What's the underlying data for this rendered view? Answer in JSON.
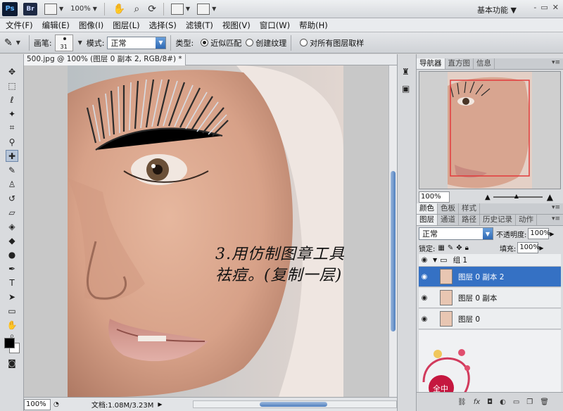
{
  "app_bar": {
    "ps_logo": "Ps",
    "br_logo": "Br",
    "zoom": "100%",
    "workspace": "基本功能",
    "window_controls": [
      "-",
      "▭",
      "✕"
    ]
  },
  "menu": [
    "文件(F)",
    "编辑(E)",
    "图像(I)",
    "图层(L)",
    "选择(S)",
    "滤镜(T)",
    "视图(V)",
    "窗口(W)",
    "帮助(H)"
  ],
  "options": {
    "brush_label": "画笔:",
    "brush_size": "31",
    "mode_label": "模式:",
    "mode_value": "正常",
    "type_label": "类型:",
    "type_options": [
      "近似匹配",
      "创建纹理"
    ],
    "sample_all_label": "对所有图层取样"
  },
  "document": {
    "tab_title": "500.jpg @ 100% (图层 0 副本 2, RGB/8#) *",
    "annotation_line1": "3.用仿制图章工具",
    "annotation_line2": "祛痘。(复制一层)",
    "zoom": "100%",
    "doc_size": "文档:1.08M/3.23M"
  },
  "navigator": {
    "tabs": [
      "导航器",
      "直方图",
      "信息"
    ],
    "zoom": "100%"
  },
  "color_panel": {
    "tabs": [
      "颜色",
      "色板",
      "样式"
    ]
  },
  "layers_panel": {
    "tabs": [
      "图层",
      "通道",
      "路径",
      "历史记录",
      "动作"
    ],
    "blend_mode": "正常",
    "opacity_label": "不透明度:",
    "opacity_value": "100%",
    "lock_label": "锁定:",
    "fill_label": "填充:",
    "fill_value": "100%",
    "group_name": "组 1",
    "layers": [
      "图层 0 副本 2",
      "图层 0 副本",
      "图层 0"
    ],
    "selected_index": 0,
    "footer_icons": [
      "链接",
      "fx",
      "蒙版",
      "调整",
      "组",
      "新建",
      "删除"
    ]
  },
  "stamp": {
    "text": "全中"
  },
  "colors": {
    "accent": "#3571c4",
    "foreground": "#000000",
    "background": "#ffffff"
  }
}
